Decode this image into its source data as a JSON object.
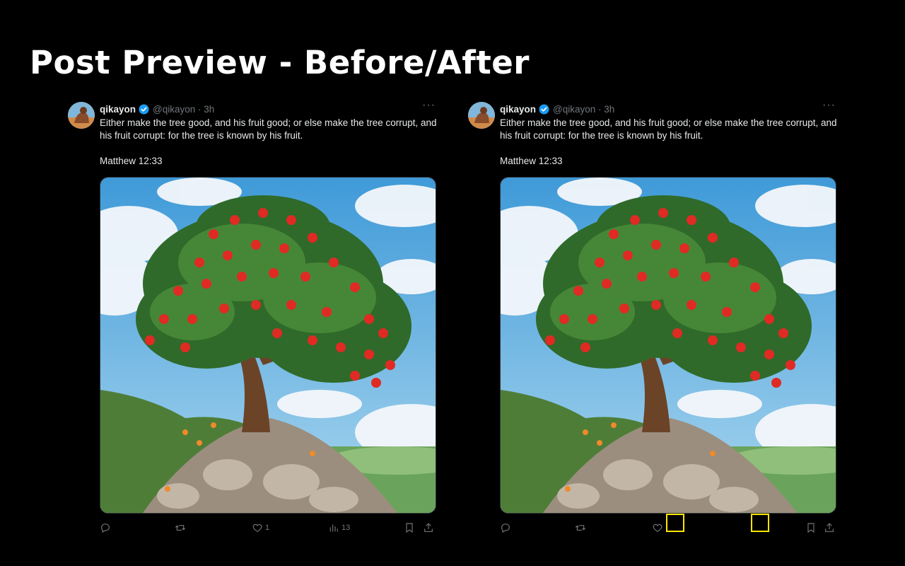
{
  "page": {
    "title": "Post Preview - Before/After"
  },
  "posts": [
    {
      "name": "qikayon",
      "handle": "@qikayon · 3h",
      "more": "···",
      "text": "Either make the tree good, and his fruit good; or else make the tree corrupt, and his fruit corrupt: for the tree is known by his fruit.",
      "reference": "Matthew 12:33",
      "actions": {
        "reply": "",
        "repost": "",
        "like": "1",
        "views": "13"
      },
      "icons": [
        "reply-icon",
        "repost-icon",
        "heart-icon",
        "views-icon",
        "bookmark-icon",
        "share-icon"
      ]
    },
    {
      "name": "qikayon",
      "handle": "@qikayon · 3h",
      "more": "···",
      "text": "Either make the tree good, and his fruit good; or else make the tree corrupt, and his fruit corrupt: for the tree is known by his fruit.",
      "reference": "Matthew 12:33",
      "actions": {
        "reply": "",
        "repost": "",
        "like": "",
        "views": ""
      },
      "icons": [
        "reply-icon",
        "repost-icon",
        "heart-icon",
        "bookmark-icon",
        "share-icon"
      ]
    }
  ],
  "colors": {
    "background": "#000000",
    "verified": "#1d9bf0",
    "highlight": "#ffe600",
    "muted": "#71767b"
  }
}
